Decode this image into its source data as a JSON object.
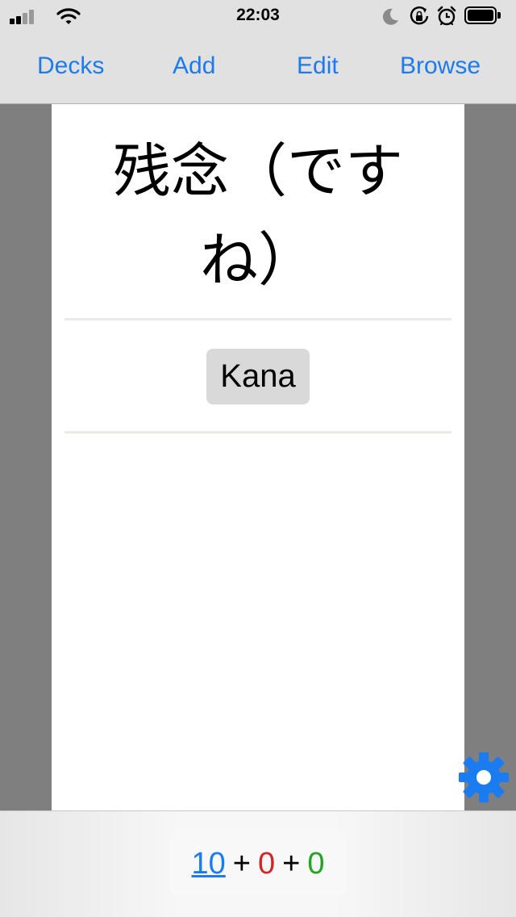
{
  "status_bar": {
    "time": "22:03",
    "icons": [
      "signal-icon",
      "wifi-icon",
      "do-not-disturb-moon-icon",
      "rotation-lock-icon",
      "alarm-icon",
      "battery-icon"
    ]
  },
  "nav": {
    "decks_label": "Decks",
    "add_label": "Add",
    "edit_label": "Edit",
    "browse_label": "Browse"
  },
  "card": {
    "front_text": "残念（ですね）",
    "hint_button_label": "Kana"
  },
  "counts": {
    "new": "10",
    "learning": "0",
    "review": "0",
    "separator": "+"
  },
  "colors": {
    "accent": "#1b7bf0",
    "new_count": "#1b7bf0",
    "learning_count": "#d42525",
    "review_count": "#1fa51f",
    "background": "#7f7f7f",
    "bars": "#e1e1e1"
  }
}
